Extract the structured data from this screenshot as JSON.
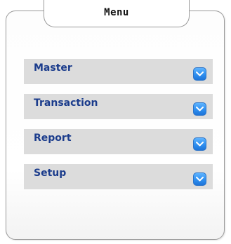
{
  "menu": {
    "title": "Menu",
    "items": [
      {
        "label": "Master",
        "icon": "chevron-down-icon"
      },
      {
        "label": "Transaction",
        "icon": "chevron-down-icon"
      },
      {
        "label": "Report",
        "icon": "chevron-down-icon"
      },
      {
        "label": "Setup",
        "icon": "chevron-down-icon"
      }
    ]
  },
  "colors": {
    "item_background": "#dcdcdc",
    "item_label": "#1b3c8c",
    "chevron_button": "#2e8ff0"
  }
}
